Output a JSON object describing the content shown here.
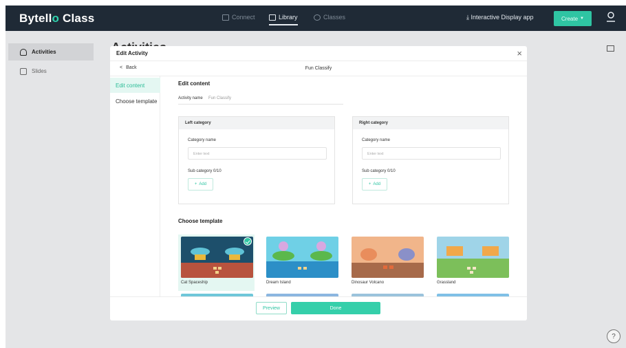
{
  "app": {
    "brand_prefix": "Bytell",
    "brand_highlight": "o",
    "brand_suffix": " Class"
  },
  "topnav": {
    "items": [
      {
        "label": "Connect",
        "icon": "connect-icon",
        "active": false
      },
      {
        "label": "Library",
        "icon": "library-icon",
        "active": true
      },
      {
        "label": "Classes",
        "icon": "classes-icon",
        "active": false
      }
    ],
    "display_app": "Interactive Display app",
    "create_label": "Create"
  },
  "sidebar": {
    "items": [
      {
        "label": "Activities",
        "icon": "trophy-icon",
        "active": true
      },
      {
        "label": "Slides",
        "icon": "slides-icon",
        "active": false
      }
    ]
  },
  "main": {
    "title": "Activities"
  },
  "modal": {
    "title": "Edit Activity",
    "back_label": "Back",
    "activity_title": "Fun Classify",
    "side": [
      {
        "label": "Edit content",
        "active": true
      },
      {
        "label": "Choose template",
        "active": false
      }
    ],
    "edit_content_heading": "Edit content",
    "activity_name_label": "Activity name",
    "activity_name_value": "Fun Classify",
    "left_category": {
      "heading": "Left category",
      "name_label": "Category name",
      "name_placeholder": "Enter text",
      "sub_label": "Sub category 0/10",
      "add_label": "Add"
    },
    "right_category": {
      "heading": "Right category",
      "name_label": "Category name",
      "name_placeholder": "Enter text",
      "sub_label": "Sub category 0/10",
      "add_label": "Add"
    },
    "choose_template_heading": "Choose template",
    "templates": [
      {
        "name": "Cat Spaceship",
        "selected": true
      },
      {
        "name": "Dream Island",
        "selected": false
      },
      {
        "name": "Dinosaur Volcano",
        "selected": false
      },
      {
        "name": "Grassland",
        "selected": false
      }
    ],
    "preview_label": "Preview",
    "done_label": "Done"
  },
  "colors": {
    "accent": "#2fc5a3",
    "topbar": "#1f2a36"
  }
}
